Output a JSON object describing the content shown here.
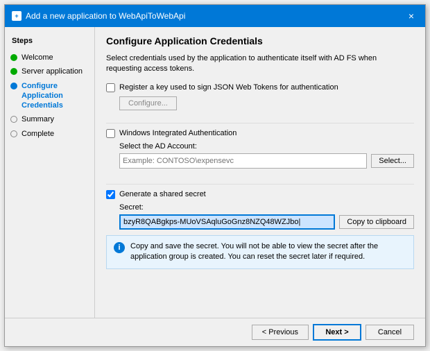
{
  "titleBar": {
    "icon": "app",
    "title": "Add a new application to WebApiToWebApi",
    "closeLabel": "×"
  },
  "pageTitle": "Configure Application Credentials",
  "description": "Select credentials used by the application to authenticate itself with AD FS when requesting access tokens.",
  "sidebar": {
    "stepsLabel": "Steps",
    "items": [
      {
        "id": "welcome",
        "label": "Welcome",
        "state": "green"
      },
      {
        "id": "server-application",
        "label": "Server application",
        "state": "green"
      },
      {
        "id": "configure-credentials",
        "label": "Configure Application Credentials",
        "state": "blue",
        "active": true
      },
      {
        "id": "summary",
        "label": "Summary",
        "state": "gray"
      },
      {
        "id": "complete",
        "label": "Complete",
        "state": "gray"
      }
    ]
  },
  "sections": {
    "jsonWebTokens": {
      "checkboxLabel": "Register a key used to sign JSON Web Tokens for authentication",
      "configureLabel": "Configure..."
    },
    "windowsAuth": {
      "checkboxLabel": "Windows Integrated Authentication",
      "adAccountLabel": "Select the AD Account:",
      "adAccountPlaceholder": "Example: CONTOSO\\expensevc",
      "selectLabel": "Select..."
    },
    "sharedSecret": {
      "checkboxLabel": "Generate a shared secret",
      "secretLabel": "Secret:",
      "secretValue": "bzyR8QABgkps-MUoVSAqluGoGnz8NZQ48WZJbo|",
      "copyLabel": "Copy to clipboard"
    }
  },
  "infoBox": {
    "text": "Copy and save the secret.  You will not be able to view the secret after the application group is created.  You can reset the secret later if required."
  },
  "footer": {
    "previousLabel": "< Previous",
    "nextLabel": "Next >",
    "cancelLabel": "Cancel"
  }
}
